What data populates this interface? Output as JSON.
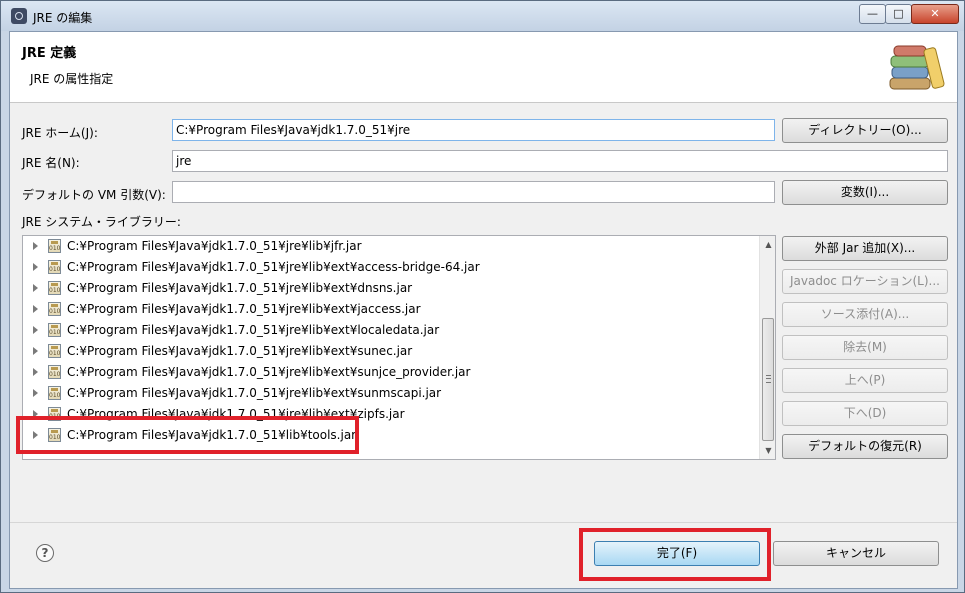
{
  "window": {
    "title": "JRE の編集",
    "min_glyph": "—",
    "max_glyph": "□",
    "close_glyph": "✕"
  },
  "header": {
    "title": "JRE 定義",
    "subtitle": "JRE の属性指定",
    "icon": "books-icon"
  },
  "form": {
    "home_label": "JRE ホーム(J):",
    "home_value": "C:¥Program Files¥Java¥jdk1.7.0_51¥jre",
    "directory_button": "ディレクトリー(O)...",
    "name_label": "JRE 名(N):",
    "name_value": "jre",
    "vmargs_label": "デフォルトの VM 引数(V):",
    "vmargs_value": "",
    "variables_button": "変数(I)...",
    "library_label": "JRE システム・ライブラリー:"
  },
  "libraries": [
    "C:¥Program Files¥Java¥jdk1.7.0_51¥jre¥lib¥jfr.jar",
    "C:¥Program Files¥Java¥jdk1.7.0_51¥jre¥lib¥ext¥access-bridge-64.jar",
    "C:¥Program Files¥Java¥jdk1.7.0_51¥jre¥lib¥ext¥dnsns.jar",
    "C:¥Program Files¥Java¥jdk1.7.0_51¥jre¥lib¥ext¥jaccess.jar",
    "C:¥Program Files¥Java¥jdk1.7.0_51¥jre¥lib¥ext¥localedata.jar",
    "C:¥Program Files¥Java¥jdk1.7.0_51¥jre¥lib¥ext¥sunec.jar",
    "C:¥Program Files¥Java¥jdk1.7.0_51¥jre¥lib¥ext¥sunjce_provider.jar",
    "C:¥Program Files¥Java¥jdk1.7.0_51¥jre¥lib¥ext¥sunmscapi.jar",
    "C:¥Program Files¥Java¥jdk1.7.0_51¥jre¥lib¥ext¥zipfs.jar",
    "C:¥Program Files¥Java¥jdk1.7.0_51¥lib¥tools.jar"
  ],
  "jar_icon_text": "010",
  "side_buttons": {
    "add_external_jar": "外部 Jar 追加(X)...",
    "javadoc_location": "Javadoc ロケーション(L)...",
    "source_attach": "ソース添付(A)...",
    "remove": "除去(M)",
    "up": "上へ(P)",
    "down": "下へ(D)",
    "restore_default": "デフォルトの復元(R)"
  },
  "footer": {
    "help": "?",
    "finish": "完了(F)",
    "cancel": "キャンセル"
  },
  "highlight_color": "#e0212a"
}
